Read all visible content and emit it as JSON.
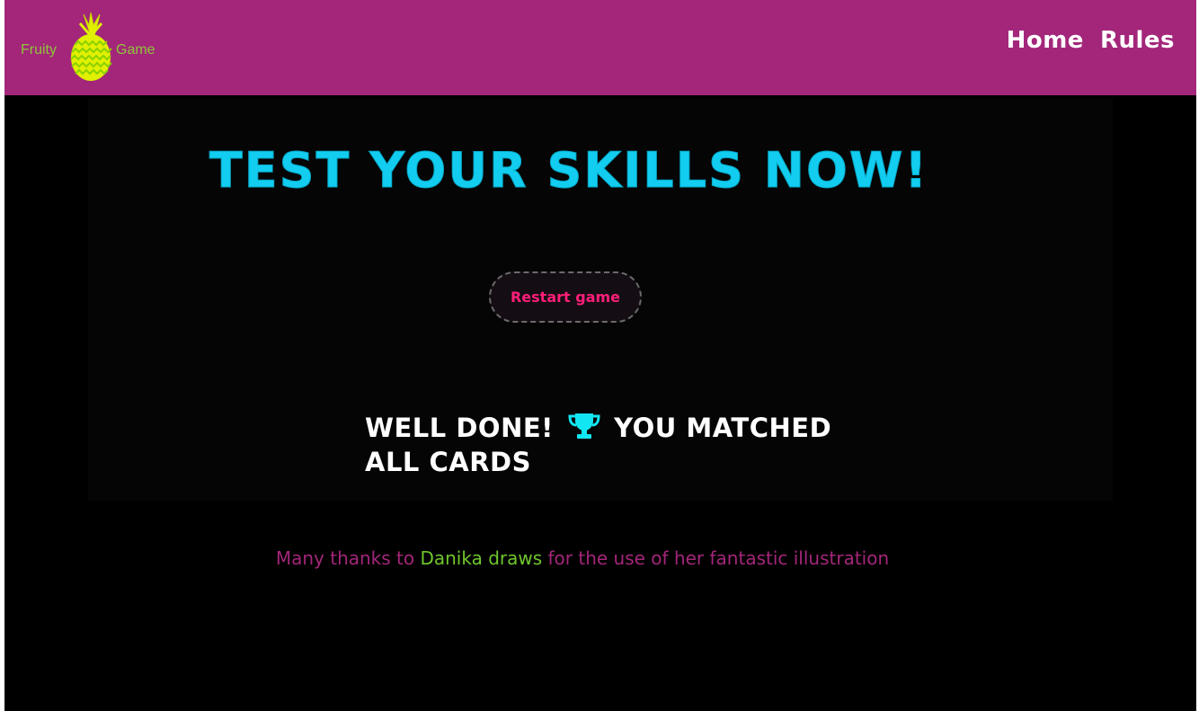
{
  "brand": {
    "word_left": "Fruity",
    "word_right": "Game",
    "logo_icon": "pineapple-icon"
  },
  "nav": {
    "items": [
      {
        "label": "Home"
      },
      {
        "label": "Rules"
      }
    ]
  },
  "main": {
    "headline": "Test your skills now!",
    "restart_label": "Restart game",
    "win_message": {
      "part1": "Well done!",
      "icon": "trophy-icon",
      "part2": "You matched",
      "part3": "all cards"
    }
  },
  "footer": {
    "credit_prefix": "Many thanks to ",
    "credit_artist": "Danika draws",
    "credit_suffix": " for the use of her fantastic illustration"
  },
  "colors": {
    "navbar": "#a3267a",
    "background": "#000000",
    "headline": "#12cdf0",
    "restart_text": "#ff1e78",
    "artist": "#6fc72c",
    "credit_text": "#a3267a",
    "logo_green": "#8fc53b",
    "pineapple_yellow": "#e0f000"
  }
}
